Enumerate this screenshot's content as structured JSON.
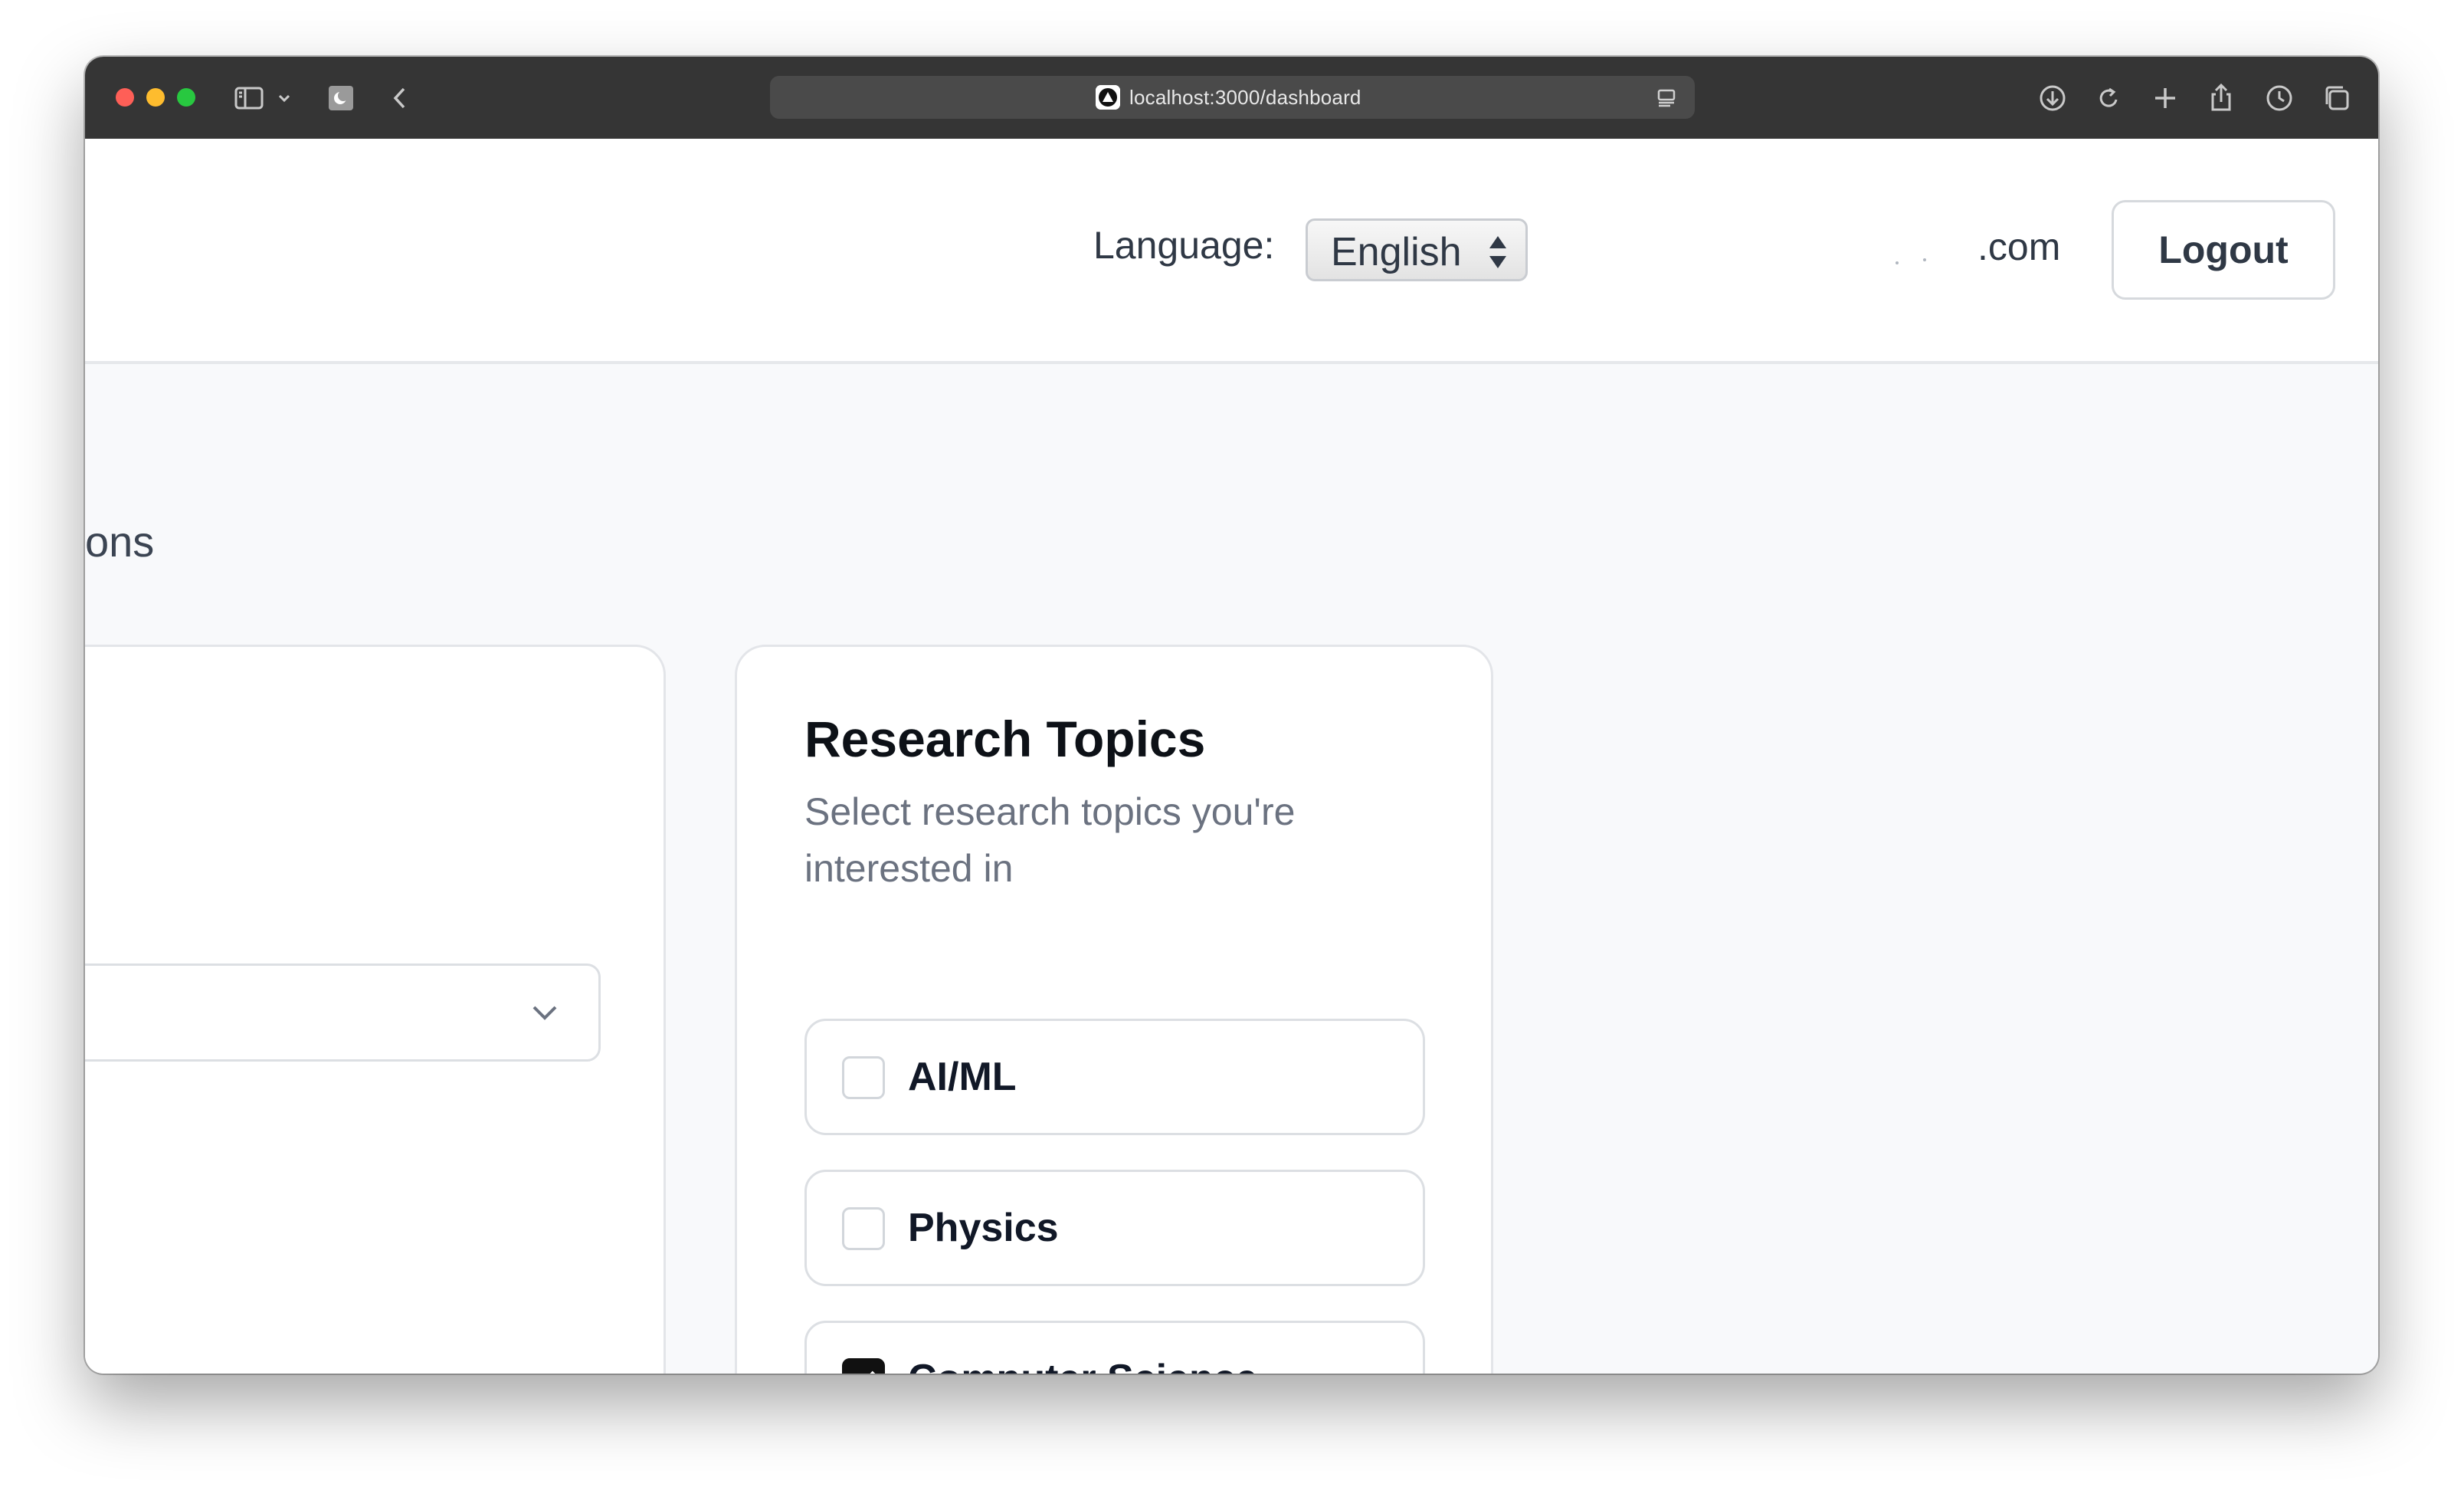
{
  "browser": {
    "url": "localhost:3000/dashboard",
    "icons": [
      "sidebar-icon",
      "chevron-down-icon",
      "extension-icon",
      "back-icon",
      "reader-icon",
      "download-icon",
      "reload-icon",
      "new-tab-icon",
      "share-icon",
      "history-icon",
      "tabs-overview-icon"
    ]
  },
  "header": {
    "language_label": "Language:",
    "language_value": "English",
    "email_suffix": ".com",
    "logout_label": "Logout"
  },
  "main": {
    "section_title_fragment": "ons",
    "research_topics": {
      "title": "Research Topics",
      "subtitle": "Select research topics you're interested in",
      "topics": [
        {
          "label": "AI/ML",
          "checked": false
        },
        {
          "label": "Physics",
          "checked": false
        },
        {
          "label": "Computer Science",
          "checked": true
        }
      ]
    }
  },
  "colors": {
    "titlebar": "#353535",
    "page_background": "#f8f9fb",
    "text_primary": "#111827",
    "text_secondary": "#6b7280",
    "checkbox_checked": "#111111"
  }
}
